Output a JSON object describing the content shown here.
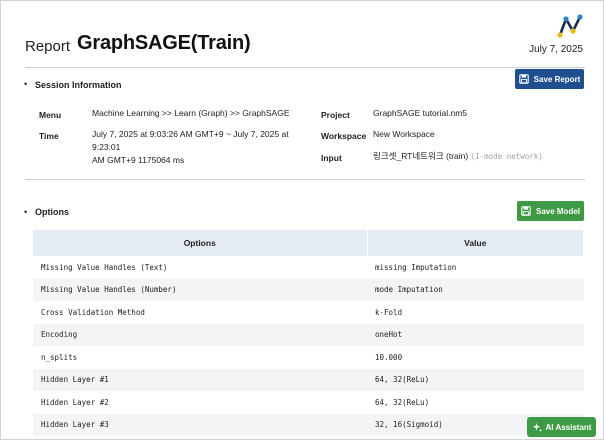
{
  "header": {
    "report_label": "Report",
    "title": "GraphSAGE(Train)",
    "date": "July 7, 2025",
    "logo_icon": "graph-logo-icon"
  },
  "session": {
    "bullet": "•",
    "title": "Session Information",
    "save_report_label": "Save Report",
    "menu_label": "Menu",
    "menu_value": "Machine Learning >> Learn (Graph) >> GraphSAGE",
    "time_label": "Time",
    "time_line1": "July 7, 2025 at 9:03:26 AM GMT+9 ~ July 7, 2025 at 9:23:01",
    "time_line2": "AM GMT+9 1175064 ms",
    "project_label": "Project",
    "project_value": "GraphSAGE tutorial.nm5",
    "workspace_label": "Workspace",
    "workspace_value": "New Workspace",
    "input_label": "Input",
    "input_value": "링크셋_RT네트워크 (train)",
    "input_note": "(1-mode network)"
  },
  "options": {
    "bullet": "•",
    "title": "Options",
    "save_model_label": "Save Model",
    "columns": [
      "Options",
      "Value"
    ],
    "rows": [
      [
        "Missing Value Handles (Text)",
        "missing Imputation"
      ],
      [
        "Missing Value Handles (Number)",
        "mode Imputation"
      ],
      [
        "Cross Validation Method",
        "k-Fold"
      ],
      [
        "Encoding",
        "oneHot"
      ],
      [
        "n_splits",
        "10.000"
      ],
      [
        "Hidden Layer #1",
        "64, 32(ReLu)"
      ],
      [
        "Hidden Layer #2",
        "64, 32(ReLu)"
      ],
      [
        "Hidden Layer #3",
        "32, 16(Sigmoid)"
      ]
    ]
  },
  "assistant": {
    "label": "AI Assistant"
  },
  "colors": {
    "primary": "#1f4f8f",
    "success": "#3f9a45",
    "table_header": "#e4ebf3"
  }
}
